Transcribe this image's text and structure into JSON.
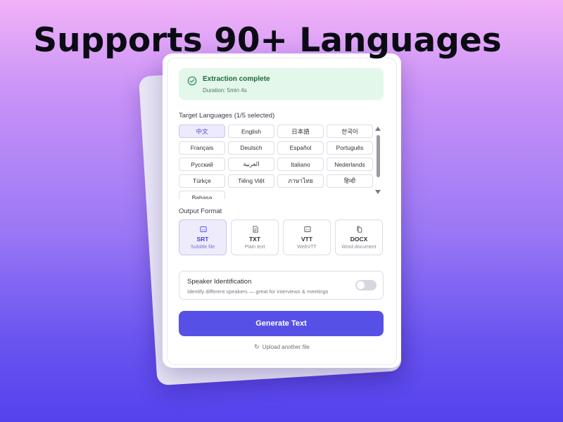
{
  "headline": "Supports 90+ Languages",
  "status": {
    "title": "Extraction complete",
    "duration": "Duration: 5min 4s",
    "icon": "check-circle-icon",
    "color": "#1d6a3c"
  },
  "languages": {
    "label": "Target Languages (1/5 selected)",
    "items": [
      {
        "label": "中文",
        "selected": true
      },
      {
        "label": "English",
        "selected": false
      },
      {
        "label": "日本語",
        "selected": false
      },
      {
        "label": "한국어",
        "selected": false
      },
      {
        "label": "Français",
        "selected": false
      },
      {
        "label": "Deutsch",
        "selected": false
      },
      {
        "label": "Español",
        "selected": false
      },
      {
        "label": "Português",
        "selected": false
      },
      {
        "label": "Русский",
        "selected": false
      },
      {
        "label": "العربية",
        "selected": false
      },
      {
        "label": "Italiano",
        "selected": false
      },
      {
        "label": "Nederlands",
        "selected": false
      },
      {
        "label": "Türkçe",
        "selected": false
      },
      {
        "label": "Tiếng Việt",
        "selected": false
      },
      {
        "label": "ภาษาไทย",
        "selected": false
      },
      {
        "label": "हिन्दी",
        "selected": false
      },
      {
        "label": "Bahasa",
        "selected": false
      }
    ]
  },
  "output": {
    "label": "Output Format",
    "formats": [
      {
        "name": "SRT",
        "desc": "Subtitle file",
        "icon": "subtitle-icon",
        "selected": true
      },
      {
        "name": "TXT",
        "desc": "Plain text",
        "icon": "document-icon",
        "selected": false
      },
      {
        "name": "VTT",
        "desc": "WebVTT",
        "icon": "caption-icon",
        "selected": false
      },
      {
        "name": "DOCX",
        "desc": "Word document",
        "icon": "word-doc-icon",
        "selected": false
      }
    ]
  },
  "speaker": {
    "title": "Speaker Identification",
    "desc": "Identify different speakers — great for interviews & meetings",
    "enabled": false
  },
  "generate_label": "Generate Text",
  "upload_label": "Upload another file",
  "colors": {
    "accent": "#5750e6",
    "success_bg": "#e3f7ea"
  }
}
